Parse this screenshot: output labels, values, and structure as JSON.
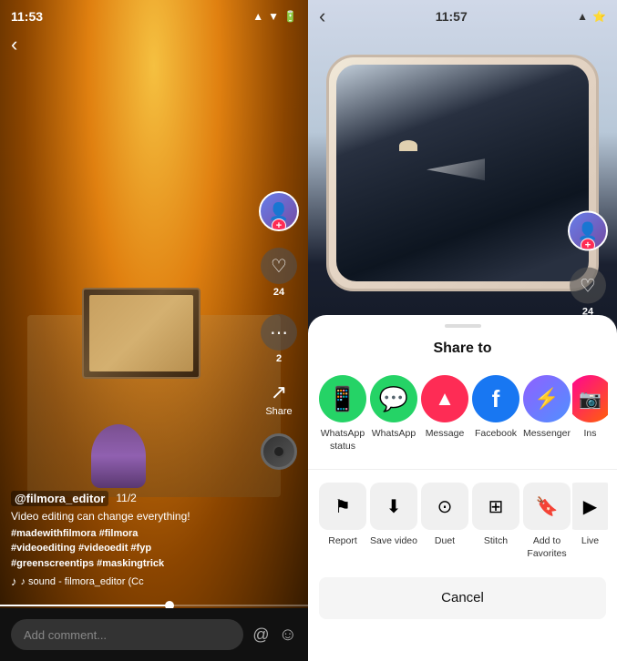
{
  "left": {
    "time": "11:53",
    "username": "@filmora_editor",
    "post_number": "11/2",
    "caption": "Video editing can change everything!",
    "hashtags": "#madewithfilmora #filmora\n#videoediting #videoedit #fyp\n#greenscreentips #maskingtrick",
    "sound": "♪ sound - filmora_editor (Cc",
    "comment_placeholder": "Add comment...",
    "like_count": "24",
    "comment_count": "2",
    "share_label": "Share",
    "back": "‹"
  },
  "right": {
    "time": "11:57",
    "back": "‹",
    "share_panel": {
      "title": "Share to",
      "items": [
        {
          "id": "whatsapp-status",
          "label": "WhatsApp\nstatus",
          "color": "#25D366",
          "icon": "💬"
        },
        {
          "id": "whatsapp",
          "label": "WhatsApp",
          "color": "#25D366",
          "icon": "💬"
        },
        {
          "id": "message",
          "label": "Message",
          "color": "#fe2c55",
          "icon": "✉"
        },
        {
          "id": "facebook",
          "label": "Facebook",
          "color": "#1877F2",
          "icon": "f"
        },
        {
          "id": "messenger",
          "label": "Messenger",
          "color": "#9060FF",
          "icon": "m"
        }
      ],
      "actions": [
        {
          "id": "report",
          "label": "Report",
          "icon": "⚑"
        },
        {
          "id": "save-video",
          "label": "Save video",
          "icon": "⬇"
        },
        {
          "id": "duet",
          "label": "Duet",
          "icon": "⊙"
        },
        {
          "id": "stitch",
          "label": "Stitch",
          "icon": "⊞"
        },
        {
          "id": "add-to-favorites",
          "label": "Add to\nFavorites",
          "icon": "🔖"
        }
      ],
      "cancel": "Cancel"
    },
    "like_count": "24"
  }
}
